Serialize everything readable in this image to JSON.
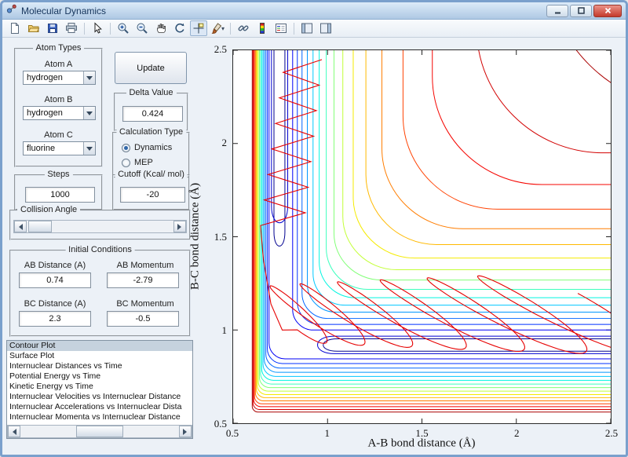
{
  "window": {
    "title": "Molecular Dynamics"
  },
  "toolbar": {
    "icons": [
      "new-document",
      "open-file",
      "save-figure",
      "print-figure",
      "edit-plot",
      "zoom-in",
      "zoom-out",
      "pan",
      "rotate-3d",
      "data-cursor",
      "brush-data",
      "link-plot",
      "insert-colorbar",
      "insert-legend",
      "show-plot-tools",
      "hide-plot-tools"
    ],
    "active_icon": "data-cursor",
    "brush_caret": "▾"
  },
  "controls": {
    "atom_types": {
      "title": "Atom Types",
      "atom_a_label": "Atom A",
      "atom_a_value": "hydrogen",
      "atom_b_label": "Atom B",
      "atom_b_value": "hydrogen",
      "atom_c_label": "Atom C",
      "atom_c_value": "fluorine"
    },
    "update_button": "Update",
    "delta": {
      "title": "Delta Value",
      "value": "0.424"
    },
    "calculation_type": {
      "title": "Calculation Type",
      "option_dynamics": "Dynamics",
      "option_mep": "MEP",
      "selected": "Dynamics"
    },
    "steps": {
      "title": "Steps",
      "value": "1000"
    },
    "cutoff": {
      "title": "Cutoff (Kcal/ mol)",
      "value": "-20"
    },
    "collision_angle": {
      "title": "Collision Angle"
    },
    "initial_conditions": {
      "title": "Initial Conditions",
      "ab_distance_label": "AB Distance (A)",
      "ab_distance_value": "0.74",
      "ab_momentum_label": "AB Momentum",
      "ab_momentum_value": "-2.79",
      "bc_distance_label": "BC Distance (A)",
      "bc_distance_value": "2.3",
      "bc_momentum_label": "BC Momentum",
      "bc_momentum_value": "-0.5"
    },
    "plot_list": {
      "selected_index": 0,
      "items": [
        "Contour Plot",
        "Surface Plot",
        "Internuclear Distances vs Time",
        "Potential Energy vs Time",
        "Kinetic Energy vs Time",
        "Internuclear Velocities vs Internuclear Distance",
        "Internuclear Accelerations vs Internuclear Dista",
        "Internuclear Momenta vs Internuclear Distance"
      ]
    }
  },
  "chart_data": {
    "type": "contour",
    "xlabel": "A-B bond distance (Å)",
    "ylabel": "B-C bond distance (Å)",
    "xlim": [
      0.5,
      2.5
    ],
    "ylim": [
      0.5,
      2.5
    ],
    "xticks": [
      0.5,
      1,
      1.5,
      2,
      2.5
    ],
    "yticks": [
      0.5,
      1,
      1.5,
      2,
      2.5
    ],
    "xtick_labels": [
      "0.5",
      "1",
      "1.5",
      "2",
      "2.5"
    ],
    "ytick_labels_top_to_bottom": [
      "2.5",
      "2",
      "1.5",
      "1",
      "0.5"
    ],
    "grid": false,
    "colormap": "jet",
    "contours": {
      "outer_l": [
        {
          "color": "#0000f5",
          "x": 0.815,
          "y": 1.0,
          "r": 0.11
        },
        {
          "color": "#0032ff",
          "x": 0.84,
          "y": 1.03,
          "r": 0.12
        },
        {
          "color": "#0064ff",
          "x": 0.865,
          "y": 1.062,
          "r": 0.135
        },
        {
          "color": "#0096ff",
          "x": 0.893,
          "y": 1.096,
          "r": 0.15
        },
        {
          "color": "#00c8ff",
          "x": 0.923,
          "y": 1.133,
          "r": 0.17
        },
        {
          "color": "#00f5e1",
          "x": 0.956,
          "y": 1.173,
          "r": 0.19
        },
        {
          "color": "#3cffbe",
          "x": 0.993,
          "y": 1.218,
          "r": 0.22
        },
        {
          "color": "#82ff78",
          "x": 1.034,
          "y": 1.268,
          "r": 0.25
        },
        {
          "color": "#c3ff37",
          "x": 1.081,
          "y": 1.323,
          "r": 0.285
        },
        {
          "color": "#f5eb00",
          "x": 1.136,
          "y": 1.386,
          "r": 0.325
        },
        {
          "color": "#ffb900",
          "x": 1.203,
          "y": 1.458,
          "r": 0.375
        },
        {
          "color": "#ff7d00",
          "x": 1.288,
          "y": 1.543,
          "r": 0.43
        },
        {
          "color": "#ff4100",
          "x": 1.4,
          "y": 1.648,
          "r": 0.5
        },
        {
          "color": "#f50500",
          "x": 1.555,
          "y": 1.78,
          "r": 0.58
        },
        {
          "color": "#d20000",
          "x": 1.79,
          "y": 1.95,
          "r": 0.67
        },
        {
          "color": "#aa0000",
          "x": 2.16,
          "y": 2.19,
          "r": 0.78
        }
      ],
      "inner_l": [
        {
          "color": "#0000f5",
          "x": 0.69,
          "y": 0.845,
          "r": 0.085
        },
        {
          "color": "#0032ff",
          "x": 0.681,
          "y": 0.82,
          "r": 0.08
        },
        {
          "color": "#0064ff",
          "x": 0.673,
          "y": 0.796,
          "r": 0.075
        },
        {
          "color": "#0096ff",
          "x": 0.665,
          "y": 0.773,
          "r": 0.07
        },
        {
          "color": "#00c8ff",
          "x": 0.658,
          "y": 0.751,
          "r": 0.066
        },
        {
          "color": "#00f5e1",
          "x": 0.651,
          "y": 0.73,
          "r": 0.062
        },
        {
          "color": "#3cffbe",
          "x": 0.645,
          "y": 0.71,
          "r": 0.058
        },
        {
          "color": "#82ff78",
          "x": 0.639,
          "y": 0.691,
          "r": 0.055
        },
        {
          "color": "#c3ff37",
          "x": 0.633,
          "y": 0.672,
          "r": 0.052
        },
        {
          "color": "#f5eb00",
          "x": 0.628,
          "y": 0.654,
          "r": 0.049
        },
        {
          "color": "#ffb900",
          "x": 0.623,
          "y": 0.637,
          "r": 0.046
        },
        {
          "color": "#ff7d00",
          "x": 0.618,
          "y": 0.62,
          "r": 0.043
        },
        {
          "color": "#ff4100",
          "x": 0.613,
          "y": 0.604,
          "r": 0.04
        },
        {
          "color": "#f50500",
          "x": 0.609,
          "y": 0.589,
          "r": 0.037
        },
        {
          "color": "#d20000",
          "x": 0.605,
          "y": 0.574,
          "r": 0.034
        },
        {
          "color": "#aa0000",
          "x": 0.601,
          "y": 0.56,
          "r": 0.031
        }
      ],
      "v_lens": [
        {
          "color": "#00008f",
          "x1": 0.716,
          "x2": 0.774,
          "y_end": 1.425,
          "r": 0.1
        },
        {
          "color": "#0000d2",
          "x1": 0.703,
          "x2": 0.789,
          "y_end": 1.545,
          "r": 0.12
        }
      ],
      "h_lens": [
        {
          "color": "#00008f",
          "y1": 0.886,
          "y2": 0.953,
          "x_end": 0.952,
          "r": 0.1
        },
        {
          "color": "#0000d2",
          "y1": 0.873,
          "y2": 0.967,
          "x_end": 0.917,
          "r": 0.12
        }
      ]
    },
    "trajectory": {
      "color": "#e60000",
      "zigzag": {
        "y_top": 2.45,
        "y_bottom": 1.56,
        "half_periods": 13,
        "right_start": 0.97,
        "right_end": 0.875,
        "left_start": 0.775,
        "left_end": 0.645
      },
      "link": [
        [
          0.66,
          1.38
        ],
        [
          0.7,
          1.14
        ],
        [
          0.76,
          1.0
        ]
      ],
      "loops": {
        "steps": 340,
        "cycles": 6.5,
        "phase0": 3.7,
        "tilt": 1.25,
        "x0": 0.8,
        "x_gain": 1.62,
        "x_pow": 1.3,
        "amp_x0": 0.17,
        "amp_x1": 0.4,
        "y_mid": 1.08,
        "amp_y0": 0.15,
        "amp_y1": 0.07
      }
    }
  }
}
